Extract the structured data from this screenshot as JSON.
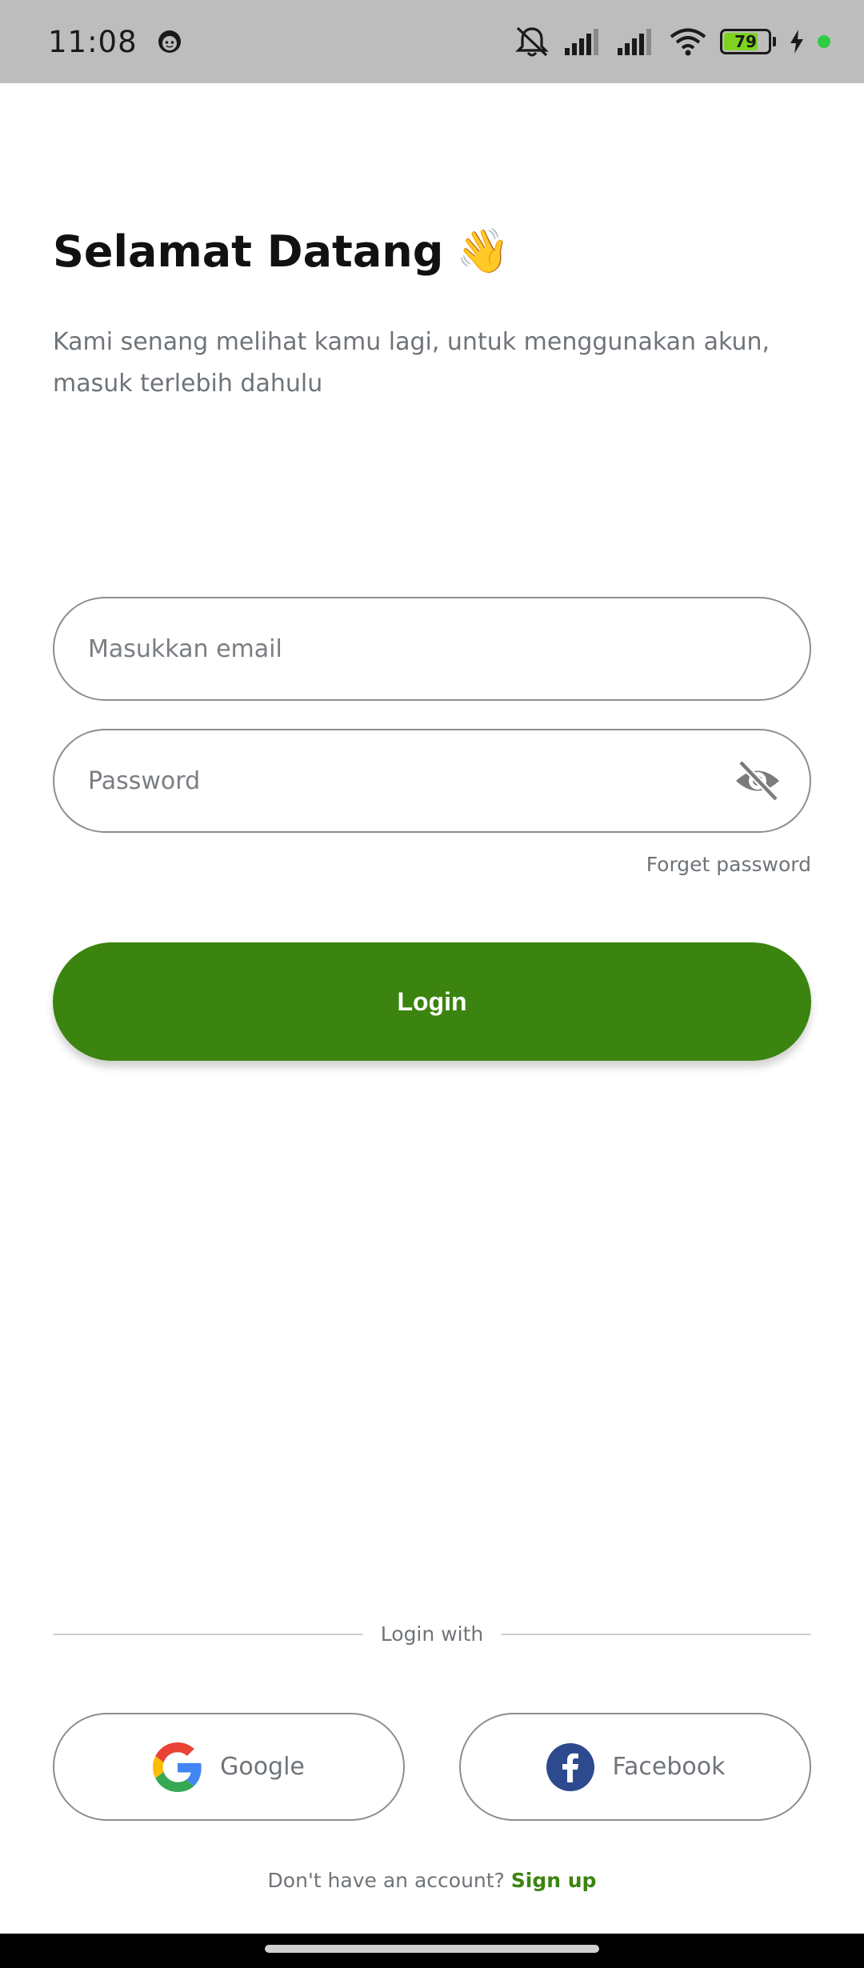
{
  "status_bar": {
    "time": "11:08",
    "battery_level": "79",
    "battery_fraction": 0.79,
    "icons": [
      "face-icon",
      "mute-bell-icon",
      "signal-icon",
      "signal-icon",
      "wifi-icon",
      "battery-icon",
      "charging-icon",
      "green-dot-icon"
    ]
  },
  "header": {
    "title": "Selamat Datang",
    "emoji": "👋",
    "subtitle": "Kami senang melihat kamu lagi, untuk menggunakan akun, masuk terlebih dahulu"
  },
  "form": {
    "email_placeholder": "Masukkan email",
    "email_value": "",
    "password_placeholder": "Password",
    "password_value": "",
    "password_toggle_icon": "eye-off-icon",
    "forget_password": "Forget password",
    "login_label": "Login"
  },
  "social": {
    "divider_text": "Login with",
    "google_label": "Google",
    "facebook_label": "Facebook"
  },
  "footer": {
    "prompt": "Don't have an account?",
    "signup": "Sign up"
  },
  "colors": {
    "primary": "#3b840f",
    "status_bar_bg": "#bdbdbd",
    "muted_text": "#6f7479",
    "border": "#8e8e8e"
  }
}
